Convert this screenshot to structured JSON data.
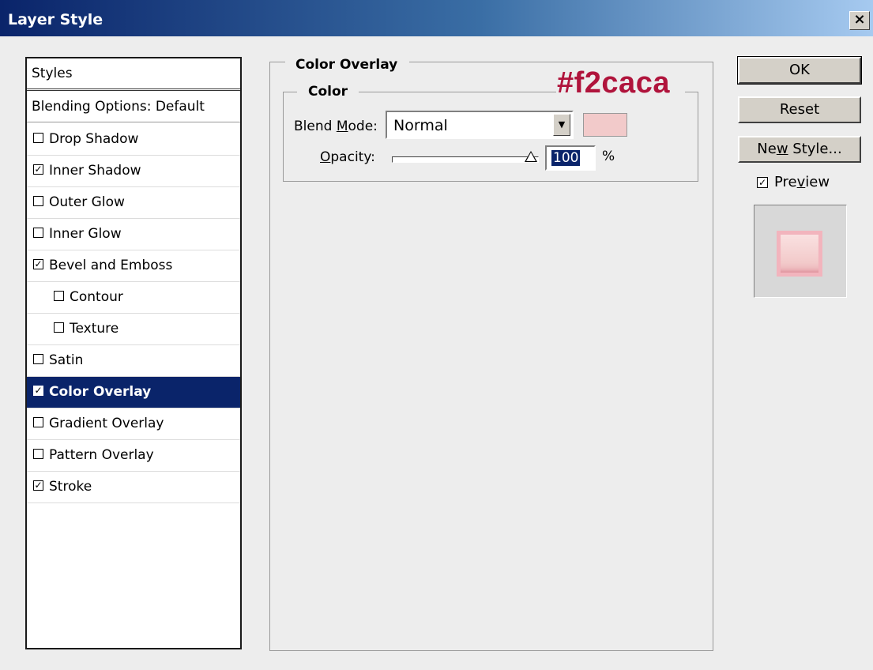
{
  "window": {
    "title": "Layer Style",
    "close_glyph": "×"
  },
  "styles_panel": {
    "header": "Styles",
    "blending_options": "Blending Options: Default",
    "items": [
      {
        "label": "Drop Shadow",
        "checked": false,
        "indent": false
      },
      {
        "label": "Inner Shadow",
        "checked": true,
        "indent": false
      },
      {
        "label": "Outer Glow",
        "checked": false,
        "indent": false
      },
      {
        "label": "Inner Glow",
        "checked": false,
        "indent": false
      },
      {
        "label": "Bevel and Emboss",
        "checked": true,
        "indent": false
      },
      {
        "label": "Contour",
        "checked": false,
        "indent": true
      },
      {
        "label": "Texture",
        "checked": false,
        "indent": true
      },
      {
        "label": "Satin",
        "checked": false,
        "indent": false
      },
      {
        "label": "Color Overlay",
        "checked": true,
        "indent": false,
        "selected": true
      },
      {
        "label": "Gradient Overlay",
        "checked": false,
        "indent": false
      },
      {
        "label": "Pattern Overlay",
        "checked": false,
        "indent": false
      },
      {
        "label": "Stroke",
        "checked": true,
        "indent": false
      }
    ]
  },
  "color_overlay": {
    "section_title": "Color Overlay",
    "group_title": "Color",
    "annotation": "#f2caca",
    "blend_mode": {
      "label_pre": "Blend ",
      "label_u": "M",
      "label_post": "ode:",
      "value": "Normal"
    },
    "swatch_color": "#f2caca",
    "opacity": {
      "label_u": "O",
      "label_post": "pacity:",
      "value": "100",
      "unit": "%",
      "level": 1.0
    }
  },
  "buttons": {
    "ok": "OK",
    "reset": "Reset",
    "new_style_pre": "Ne",
    "new_style_u": "w",
    "new_style_post": " Style..."
  },
  "preview": {
    "label_pre": "Pre",
    "label_u": "v",
    "label_post": "iew",
    "checked": true
  },
  "colors": {
    "selection": "#0a246a",
    "annotation": "#b0143c",
    "overlay": "#f2caca"
  }
}
